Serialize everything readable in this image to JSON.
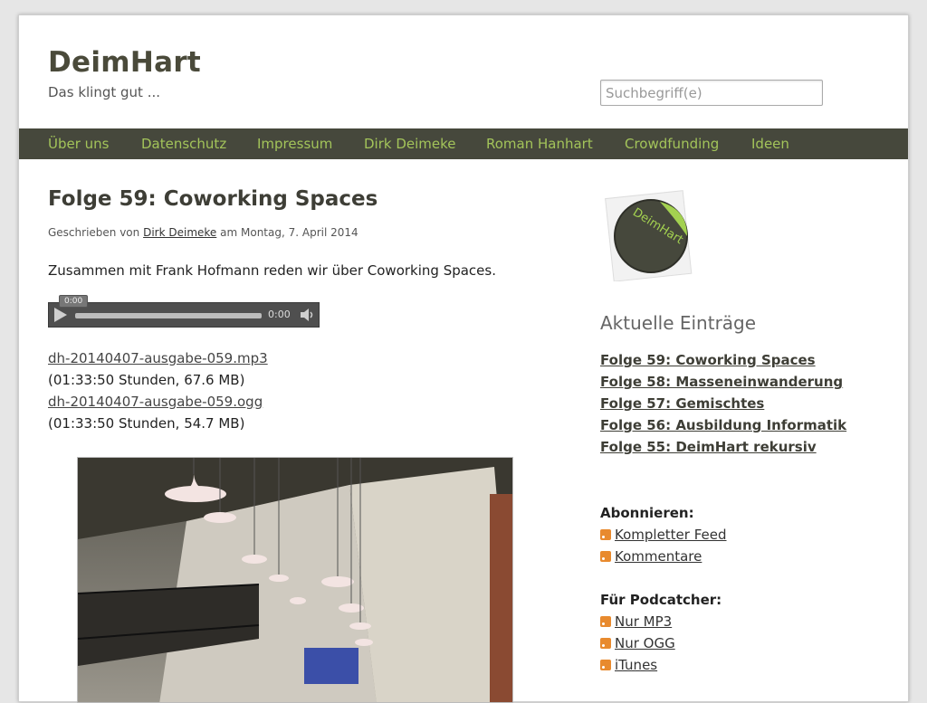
{
  "site": {
    "title": "DeimHart",
    "tagline": "Das klingt gut ..."
  },
  "search": {
    "placeholder": "Suchbegriff(e)"
  },
  "nav": [
    "Über uns",
    "Datenschutz",
    "Impressum",
    "Dirk Deimeke",
    "Roman Hanhart",
    "Crowdfunding",
    "Ideen"
  ],
  "post": {
    "title": "Folge 59: Coworking Spaces",
    "byline_prefix": "Geschrieben von",
    "author": "Dirk Deimeke",
    "byline_suffix": "am Montag, 7. April 2014",
    "intro": "Zusammen mit Frank Hofmann reden wir über Coworking Spaces.",
    "player": {
      "position": "0:00",
      "duration": "0:00"
    },
    "downloads": [
      {
        "file": "dh-20140407-ausgabe-059.mp3",
        "info": "(01:33:50 Stunden, 67.6 MB)"
      },
      {
        "file": "dh-20140407-ausgabe-059.ogg",
        "info": "(01:33:50 Stunden, 54.7 MB)"
      }
    ]
  },
  "sidebar": {
    "logo_text": "DeimHart",
    "recent_title": "Aktuelle Einträge",
    "recent": [
      "Folge 59: Coworking Spaces",
      "Folge 58: Masseneinwanderung",
      "Folge 57: Gemischtes",
      "Folge 56: Ausbildung Informatik",
      "Folge 55: DeimHart rekursiv"
    ],
    "subscribe_title": "Abonnieren:",
    "subscribe": [
      "Kompletter Feed",
      "Kommentare"
    ],
    "podcatcher_title": "Für Podcatcher:",
    "podcatcher": [
      "Nur MP3",
      "Nur OGG",
      "iTunes"
    ]
  },
  "colors": {
    "nav_bg": "#46483c",
    "nav_link": "#a3c45a",
    "logo_accent": "#a3d150",
    "rss": "#e88a2e"
  }
}
